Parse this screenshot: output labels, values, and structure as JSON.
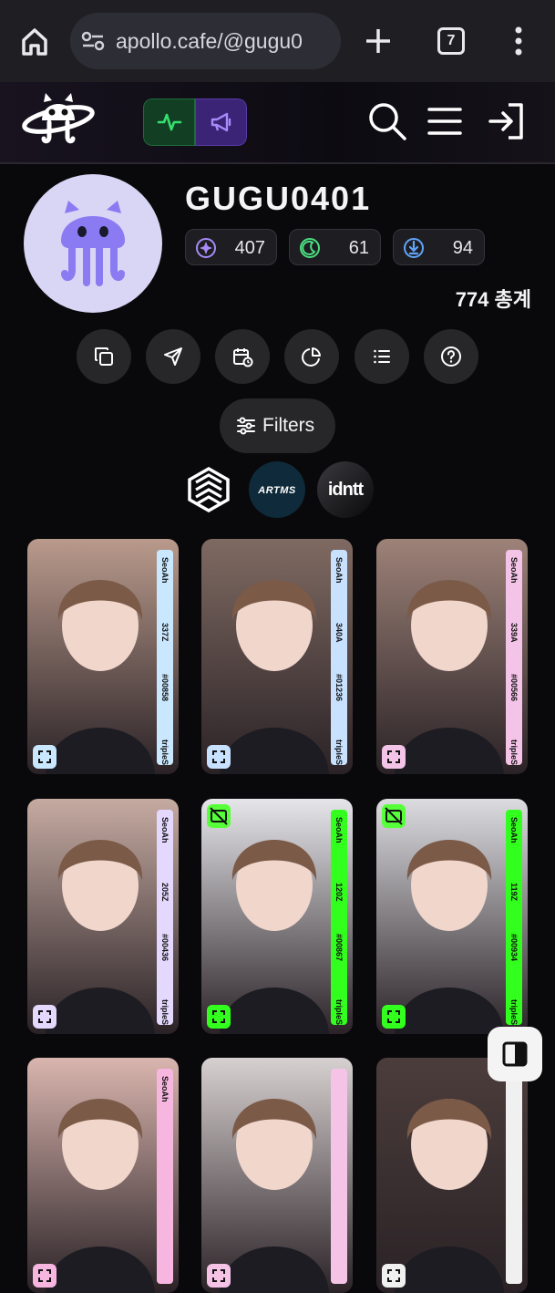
{
  "browser": {
    "url": "apollo.cafe/@gugu0",
    "tab_count": "7"
  },
  "nav": {
    "logo": "apollo jellyfish logo",
    "activity_icon": "activity-icon",
    "announce_icon": "megaphone-icon",
    "search_icon": "search-icon",
    "menu_icon": "menu-icon",
    "signin_icon": "sign-in-icon"
  },
  "profile": {
    "username": "GUGU0401",
    "stats": [
      {
        "icon": "cosmo-icon",
        "value": "407",
        "color": "#a78bfa"
      },
      {
        "icon": "moon-icon",
        "value": "61",
        "color": "#4ade80"
      },
      {
        "icon": "gravity-icon",
        "value": "94",
        "color": "#60a5fa"
      }
    ],
    "total": "774 총계"
  },
  "actions": [
    "copy-icon",
    "send-icon",
    "calendar-icon",
    "pie-chart-icon",
    "list-icon",
    "help-icon"
  ],
  "filters": {
    "label": "Filters"
  },
  "brands": [
    "tripleS",
    "ARTMS",
    "idntt"
  ],
  "cards": [
    {
      "member": "SeoAh",
      "serial": "337Z",
      "number": "#00858",
      "group": "tripleS",
      "strip_color": "#c9e8ff",
      "bg": "#b99a8c"
    },
    {
      "member": "SeoAh",
      "serial": "340A",
      "number": "#01236",
      "group": "tripleS",
      "strip_color": "#c8e1ff",
      "bg": "#7f6a62"
    },
    {
      "member": "SeoAh",
      "serial": "339A",
      "number": "#00566",
      "group": "tripleS",
      "strip_color": "#f3c4e7",
      "bg": "#9d8278"
    },
    {
      "member": "SeoAh",
      "serial": "205Z",
      "number": "#00436",
      "group": "tripleS",
      "strip_color": "#e4d8ff",
      "bg": "#c5aaa1"
    },
    {
      "member": "SeoAh",
      "serial": "120Z",
      "number": "#00867",
      "group": "tripleS",
      "strip_color": "#32ff1d",
      "bg": "#e6e6ea"
    },
    {
      "member": "SeoAh",
      "serial": "119Z",
      "number": "#00934",
      "group": "tripleS",
      "strip_color": "#32ff1d",
      "bg": "#dcdce0"
    },
    {
      "member": "SeoAh",
      "serial": "",
      "number": "",
      "group": "",
      "strip_color": "#f7b6df",
      "bg": "#d9b5ae"
    },
    {
      "member": "",
      "serial": "",
      "number": "",
      "group": "",
      "strip_color": "#f4c3e6",
      "bg": "#d7d0d0"
    },
    {
      "member": "",
      "serial": "",
      "number": "",
      "group": "",
      "strip_color": "#f0f0f0",
      "bg": "#4b3d3b"
    }
  ],
  "sidebar_toggle": "sidebar-panel-icon"
}
